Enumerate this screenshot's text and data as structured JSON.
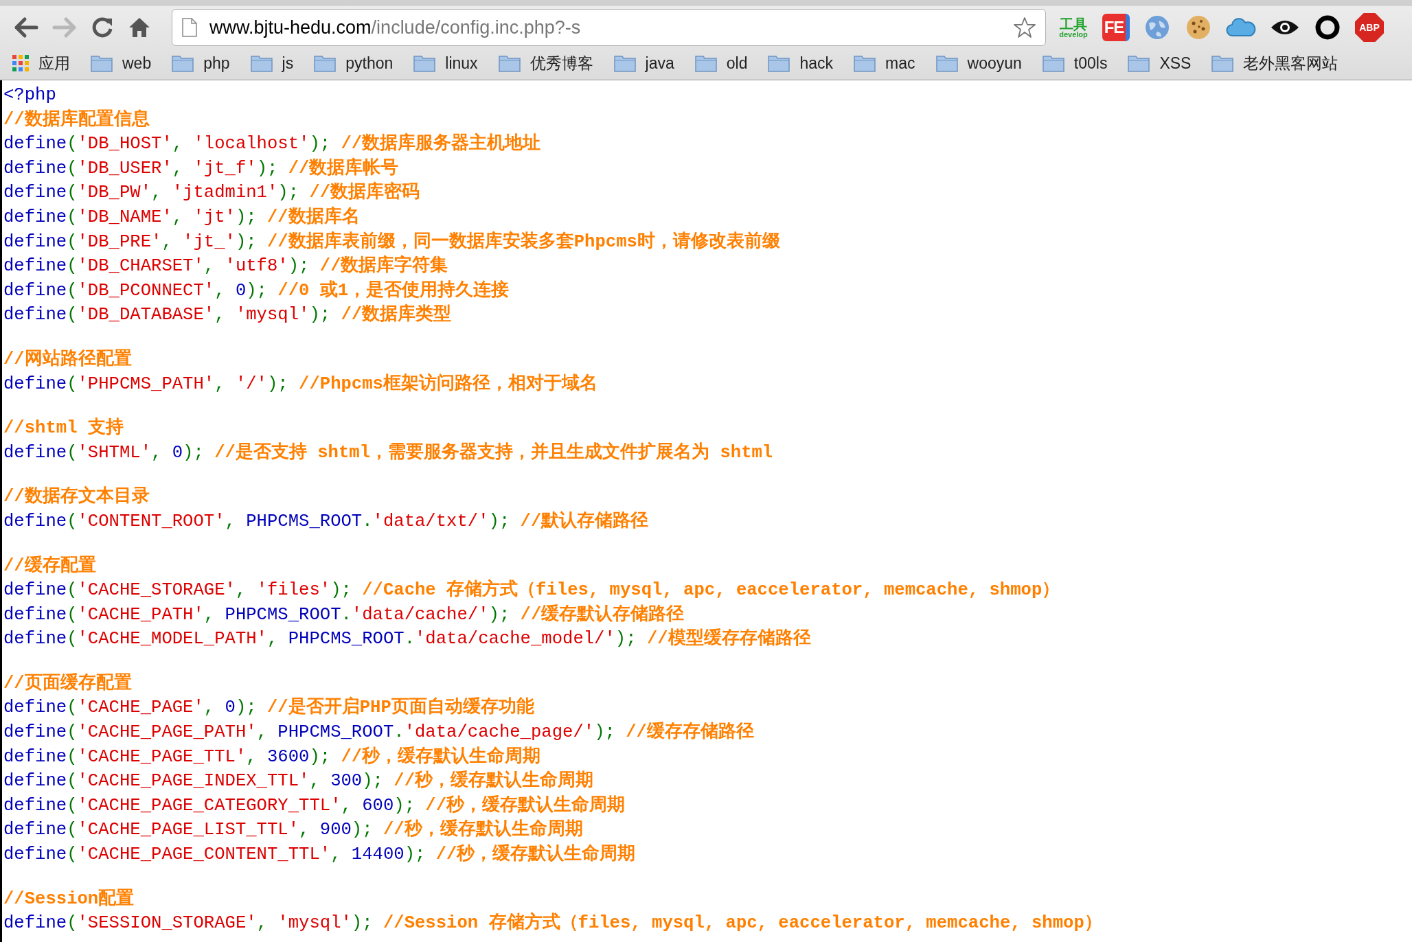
{
  "toolbar": {
    "url_host": "www.bjtu-hedu.com",
    "url_path": "/include/config.inc.php?-s",
    "extensions": [
      {
        "kind": "tool",
        "label": "工具",
        "sublabel": "develop"
      },
      {
        "kind": "fe",
        "label": "FE"
      },
      {
        "kind": "globe"
      },
      {
        "kind": "cookie"
      },
      {
        "kind": "cloud"
      },
      {
        "kind": "eye"
      },
      {
        "kind": "ring"
      },
      {
        "kind": "abp",
        "label": "ABP"
      }
    ]
  },
  "bookmarks": [
    {
      "kind": "apps",
      "label": "应用"
    },
    {
      "kind": "folder",
      "label": "web"
    },
    {
      "kind": "folder",
      "label": "php"
    },
    {
      "kind": "folder",
      "label": "js"
    },
    {
      "kind": "folder",
      "label": "python"
    },
    {
      "kind": "folder",
      "label": "linux"
    },
    {
      "kind": "folder",
      "label": "优秀博客"
    },
    {
      "kind": "folder",
      "label": "java"
    },
    {
      "kind": "folder",
      "label": "old"
    },
    {
      "kind": "folder",
      "label": "hack"
    },
    {
      "kind": "folder",
      "label": "mac"
    },
    {
      "kind": "folder",
      "label": "wooyun"
    },
    {
      "kind": "folder",
      "label": "t00ls"
    },
    {
      "kind": "folder",
      "label": "XSS"
    },
    {
      "kind": "folder",
      "label": "老外黑客网站"
    }
  ],
  "code_lines": [
    {
      "kind": "code",
      "segments": [
        {
          "kind": "default",
          "text": "<?php"
        }
      ]
    },
    {
      "kind": "code",
      "segments": [
        {
          "kind": "comment",
          "text": "//数据库配置信息"
        }
      ]
    },
    {
      "kind": "code",
      "segments": [
        {
          "kind": "default",
          "text": "define"
        },
        {
          "kind": "keyword",
          "text": "("
        },
        {
          "kind": "string",
          "text": "'DB_HOST'"
        },
        {
          "kind": "keyword",
          "text": ", "
        },
        {
          "kind": "string",
          "text": "'localhost'"
        },
        {
          "kind": "keyword",
          "text": "); "
        },
        {
          "kind": "comment",
          "text": "//数据库服务器主机地址"
        }
      ]
    },
    {
      "kind": "code",
      "segments": [
        {
          "kind": "default",
          "text": "define"
        },
        {
          "kind": "keyword",
          "text": "("
        },
        {
          "kind": "string",
          "text": "'DB_USER'"
        },
        {
          "kind": "keyword",
          "text": ", "
        },
        {
          "kind": "string",
          "text": "'jt_f'"
        },
        {
          "kind": "keyword",
          "text": "); "
        },
        {
          "kind": "comment",
          "text": "//数据库帐号"
        }
      ]
    },
    {
      "kind": "code",
      "segments": [
        {
          "kind": "default",
          "text": "define"
        },
        {
          "kind": "keyword",
          "text": "("
        },
        {
          "kind": "string",
          "text": "'DB_PW'"
        },
        {
          "kind": "keyword",
          "text": ", "
        },
        {
          "kind": "string",
          "text": "'jtadmin1'"
        },
        {
          "kind": "keyword",
          "text": "); "
        },
        {
          "kind": "comment",
          "text": "//数据库密码"
        }
      ]
    },
    {
      "kind": "code",
      "segments": [
        {
          "kind": "default",
          "text": "define"
        },
        {
          "kind": "keyword",
          "text": "("
        },
        {
          "kind": "string",
          "text": "'DB_NAME'"
        },
        {
          "kind": "keyword",
          "text": ", "
        },
        {
          "kind": "string",
          "text": "'jt'"
        },
        {
          "kind": "keyword",
          "text": "); "
        },
        {
          "kind": "comment",
          "text": "//数据库名"
        }
      ]
    },
    {
      "kind": "code",
      "segments": [
        {
          "kind": "default",
          "text": "define"
        },
        {
          "kind": "keyword",
          "text": "("
        },
        {
          "kind": "string",
          "text": "'DB_PRE'"
        },
        {
          "kind": "keyword",
          "text": ", "
        },
        {
          "kind": "string",
          "text": "'jt_'"
        },
        {
          "kind": "keyword",
          "text": "); "
        },
        {
          "kind": "comment",
          "text": "//数据库表前缀，同一数据库安装多套Phpcms时，请修改表前缀"
        }
      ]
    },
    {
      "kind": "code",
      "segments": [
        {
          "kind": "default",
          "text": "define"
        },
        {
          "kind": "keyword",
          "text": "("
        },
        {
          "kind": "string",
          "text": "'DB_CHARSET'"
        },
        {
          "kind": "keyword",
          "text": ", "
        },
        {
          "kind": "string",
          "text": "'utf8'"
        },
        {
          "kind": "keyword",
          "text": "); "
        },
        {
          "kind": "comment",
          "text": "//数据库字符集"
        }
      ]
    },
    {
      "kind": "code",
      "segments": [
        {
          "kind": "default",
          "text": "define"
        },
        {
          "kind": "keyword",
          "text": "("
        },
        {
          "kind": "string",
          "text": "'DB_PCONNECT'"
        },
        {
          "kind": "keyword",
          "text": ", "
        },
        {
          "kind": "default",
          "text": "0"
        },
        {
          "kind": "keyword",
          "text": "); "
        },
        {
          "kind": "comment",
          "text": "//0 或1，是否使用持久连接"
        }
      ]
    },
    {
      "kind": "code",
      "segments": [
        {
          "kind": "default",
          "text": "define"
        },
        {
          "kind": "keyword",
          "text": "("
        },
        {
          "kind": "string",
          "text": "'DB_DATABASE'"
        },
        {
          "kind": "keyword",
          "text": ", "
        },
        {
          "kind": "string",
          "text": "'mysql'"
        },
        {
          "kind": "keyword",
          "text": "); "
        },
        {
          "kind": "comment",
          "text": "//数据库类型"
        }
      ]
    },
    {
      "kind": "blank"
    },
    {
      "kind": "code",
      "segments": [
        {
          "kind": "comment",
          "text": "//网站路径配置"
        }
      ]
    },
    {
      "kind": "code",
      "segments": [
        {
          "kind": "default",
          "text": "define"
        },
        {
          "kind": "keyword",
          "text": "("
        },
        {
          "kind": "string",
          "text": "'PHPCMS_PATH'"
        },
        {
          "kind": "keyword",
          "text": ", "
        },
        {
          "kind": "string",
          "text": "'/'"
        },
        {
          "kind": "keyword",
          "text": "); "
        },
        {
          "kind": "comment",
          "text": "//Phpcms框架访问路径，相对于域名"
        }
      ]
    },
    {
      "kind": "blank"
    },
    {
      "kind": "code",
      "segments": [
        {
          "kind": "comment",
          "text": "//shtml 支持"
        }
      ]
    },
    {
      "kind": "code",
      "segments": [
        {
          "kind": "default",
          "text": "define"
        },
        {
          "kind": "keyword",
          "text": "("
        },
        {
          "kind": "string",
          "text": "'SHTML'"
        },
        {
          "kind": "keyword",
          "text": ", "
        },
        {
          "kind": "default",
          "text": "0"
        },
        {
          "kind": "keyword",
          "text": "); "
        },
        {
          "kind": "comment",
          "text": "//是否支持 shtml，需要服务器支持，并且生成文件扩展名为 shtml"
        }
      ]
    },
    {
      "kind": "blank"
    },
    {
      "kind": "code",
      "segments": [
        {
          "kind": "comment",
          "text": "//数据存文本目录"
        }
      ]
    },
    {
      "kind": "code",
      "segments": [
        {
          "kind": "default",
          "text": "define"
        },
        {
          "kind": "keyword",
          "text": "("
        },
        {
          "kind": "string",
          "text": "'CONTENT_ROOT'"
        },
        {
          "kind": "keyword",
          "text": ", "
        },
        {
          "kind": "default",
          "text": "PHPCMS_ROOT"
        },
        {
          "kind": "keyword",
          "text": "."
        },
        {
          "kind": "string",
          "text": "'data/txt/'"
        },
        {
          "kind": "keyword",
          "text": "); "
        },
        {
          "kind": "comment",
          "text": "//默认存储路径"
        }
      ]
    },
    {
      "kind": "blank"
    },
    {
      "kind": "code",
      "segments": [
        {
          "kind": "comment",
          "text": "//缓存配置"
        }
      ]
    },
    {
      "kind": "code",
      "segments": [
        {
          "kind": "default",
          "text": "define"
        },
        {
          "kind": "keyword",
          "text": "("
        },
        {
          "kind": "string",
          "text": "'CACHE_STORAGE'"
        },
        {
          "kind": "keyword",
          "text": ", "
        },
        {
          "kind": "string",
          "text": "'files'"
        },
        {
          "kind": "keyword",
          "text": "); "
        },
        {
          "kind": "comment",
          "text": "//Cache 存储方式（files, mysql, apc, eaccelerator, memcache, shmop）"
        }
      ]
    },
    {
      "kind": "code",
      "segments": [
        {
          "kind": "default",
          "text": "define"
        },
        {
          "kind": "keyword",
          "text": "("
        },
        {
          "kind": "string",
          "text": "'CACHE_PATH'"
        },
        {
          "kind": "keyword",
          "text": ", "
        },
        {
          "kind": "default",
          "text": "PHPCMS_ROOT"
        },
        {
          "kind": "keyword",
          "text": "."
        },
        {
          "kind": "string",
          "text": "'data/cache/'"
        },
        {
          "kind": "keyword",
          "text": "); "
        },
        {
          "kind": "comment",
          "text": "//缓存默认存储路径"
        }
      ]
    },
    {
      "kind": "code",
      "segments": [
        {
          "kind": "default",
          "text": "define"
        },
        {
          "kind": "keyword",
          "text": "("
        },
        {
          "kind": "string",
          "text": "'CACHE_MODEL_PATH'"
        },
        {
          "kind": "keyword",
          "text": ", "
        },
        {
          "kind": "default",
          "text": "PHPCMS_ROOT"
        },
        {
          "kind": "keyword",
          "text": "."
        },
        {
          "kind": "string",
          "text": "'data/cache_model/'"
        },
        {
          "kind": "keyword",
          "text": "); "
        },
        {
          "kind": "comment",
          "text": "//模型缓存存储路径"
        }
      ]
    },
    {
      "kind": "blank"
    },
    {
      "kind": "code",
      "segments": [
        {
          "kind": "comment",
          "text": "//页面缓存配置"
        }
      ]
    },
    {
      "kind": "code",
      "segments": [
        {
          "kind": "default",
          "text": "define"
        },
        {
          "kind": "keyword",
          "text": "("
        },
        {
          "kind": "string",
          "text": "'CACHE_PAGE'"
        },
        {
          "kind": "keyword",
          "text": ", "
        },
        {
          "kind": "default",
          "text": "0"
        },
        {
          "kind": "keyword",
          "text": "); "
        },
        {
          "kind": "comment",
          "text": "//是否开启PHP页面自动缓存功能"
        }
      ]
    },
    {
      "kind": "code",
      "segments": [
        {
          "kind": "default",
          "text": "define"
        },
        {
          "kind": "keyword",
          "text": "("
        },
        {
          "kind": "string",
          "text": "'CACHE_PAGE_PATH'"
        },
        {
          "kind": "keyword",
          "text": ", "
        },
        {
          "kind": "default",
          "text": "PHPCMS_ROOT"
        },
        {
          "kind": "keyword",
          "text": "."
        },
        {
          "kind": "string",
          "text": "'data/cache_page/'"
        },
        {
          "kind": "keyword",
          "text": "); "
        },
        {
          "kind": "comment",
          "text": "//缓存存储路径"
        }
      ]
    },
    {
      "kind": "code",
      "segments": [
        {
          "kind": "default",
          "text": "define"
        },
        {
          "kind": "keyword",
          "text": "("
        },
        {
          "kind": "string",
          "text": "'CACHE_PAGE_TTL'"
        },
        {
          "kind": "keyword",
          "text": ", "
        },
        {
          "kind": "default",
          "text": "3600"
        },
        {
          "kind": "keyword",
          "text": "); "
        },
        {
          "kind": "comment",
          "text": "//秒，缓存默认生命周期"
        }
      ]
    },
    {
      "kind": "code",
      "segments": [
        {
          "kind": "default",
          "text": "define"
        },
        {
          "kind": "keyword",
          "text": "("
        },
        {
          "kind": "string",
          "text": "'CACHE_PAGE_INDEX_TTL'"
        },
        {
          "kind": "keyword",
          "text": ", "
        },
        {
          "kind": "default",
          "text": "300"
        },
        {
          "kind": "keyword",
          "text": "); "
        },
        {
          "kind": "comment",
          "text": "//秒，缓存默认生命周期"
        }
      ]
    },
    {
      "kind": "code",
      "segments": [
        {
          "kind": "default",
          "text": "define"
        },
        {
          "kind": "keyword",
          "text": "("
        },
        {
          "kind": "string",
          "text": "'CACHE_PAGE_CATEGORY_TTL'"
        },
        {
          "kind": "keyword",
          "text": ", "
        },
        {
          "kind": "default",
          "text": "600"
        },
        {
          "kind": "keyword",
          "text": "); "
        },
        {
          "kind": "comment",
          "text": "//秒，缓存默认生命周期"
        }
      ]
    },
    {
      "kind": "code",
      "segments": [
        {
          "kind": "default",
          "text": "define"
        },
        {
          "kind": "keyword",
          "text": "("
        },
        {
          "kind": "string",
          "text": "'CACHE_PAGE_LIST_TTL'"
        },
        {
          "kind": "keyword",
          "text": ", "
        },
        {
          "kind": "default",
          "text": "900"
        },
        {
          "kind": "keyword",
          "text": "); "
        },
        {
          "kind": "comment",
          "text": "//秒，缓存默认生命周期"
        }
      ]
    },
    {
      "kind": "code",
      "segments": [
        {
          "kind": "default",
          "text": "define"
        },
        {
          "kind": "keyword",
          "text": "("
        },
        {
          "kind": "string",
          "text": "'CACHE_PAGE_CONTENT_TTL'"
        },
        {
          "kind": "keyword",
          "text": ", "
        },
        {
          "kind": "default",
          "text": "14400"
        },
        {
          "kind": "keyword",
          "text": "); "
        },
        {
          "kind": "comment",
          "text": "//秒，缓存默认生命周期"
        }
      ]
    },
    {
      "kind": "blank"
    },
    {
      "kind": "code",
      "segments": [
        {
          "kind": "comment",
          "text": "//Session配置"
        }
      ]
    },
    {
      "kind": "code",
      "segments": [
        {
          "kind": "default",
          "text": "define"
        },
        {
          "kind": "keyword",
          "text": "("
        },
        {
          "kind": "string",
          "text": "'SESSION_STORAGE'"
        },
        {
          "kind": "keyword",
          "text": ", "
        },
        {
          "kind": "string",
          "text": "'mysql'"
        },
        {
          "kind": "keyword",
          "text": "); "
        },
        {
          "kind": "comment",
          "text": "//Session 存储方式（files, mysql, apc, eaccelerator, memcache, shmop）"
        }
      ]
    }
  ]
}
